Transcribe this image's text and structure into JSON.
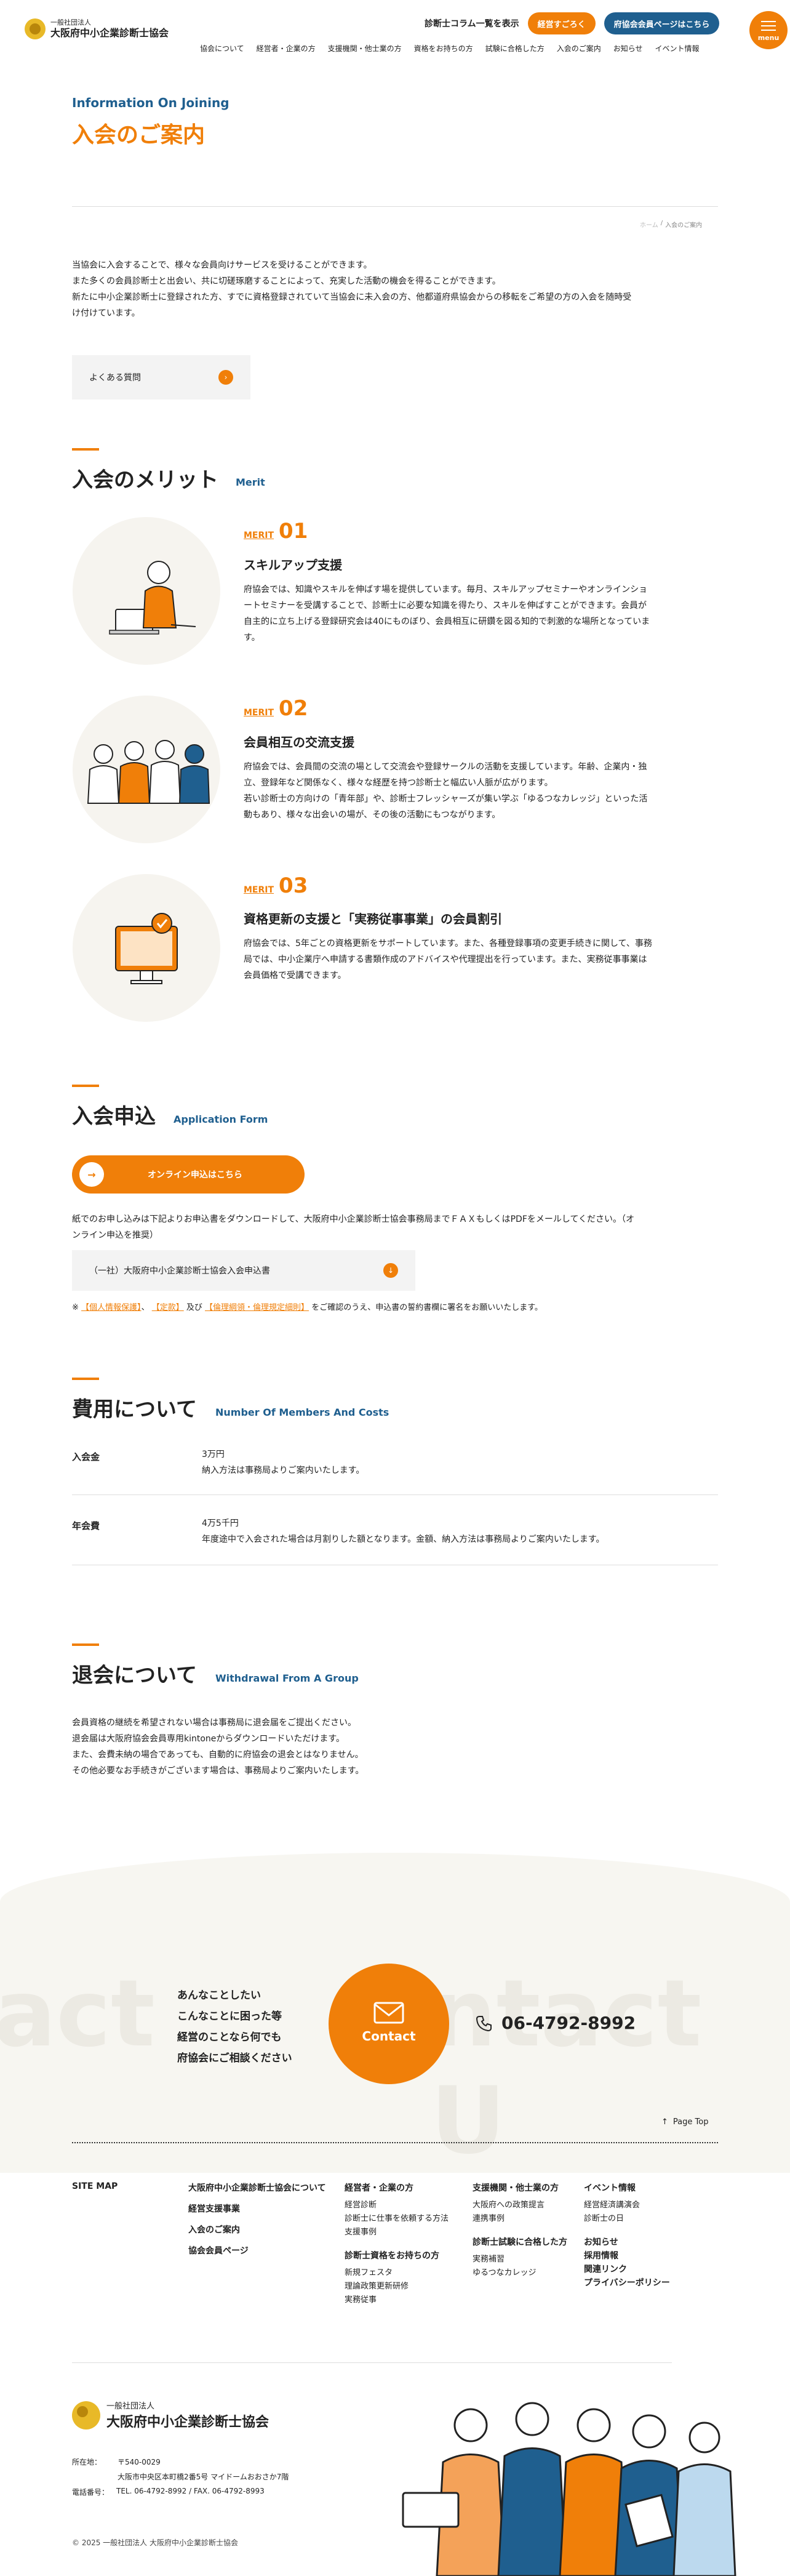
{
  "header": {
    "logo_small": "一般社団法人",
    "logo_large": "大阪府中小企業診断士協会",
    "column_link": "診断士コラム一覧を表示",
    "btn_join": "経営すごろく",
    "btn_member": "府協会会員ページはこちら",
    "menu_label": "menu",
    "nav": [
      "協会について",
      "経営者・企業の方",
      "支援機関・他士業の方",
      "資格をお持ちの方",
      "試験に合格した方",
      "入会のご案内",
      "お知らせ",
      "イベント情報"
    ]
  },
  "title": {
    "en": "Information On Joining",
    "ja": "入会のご案内",
    "breadcrumb_home": "ホーム",
    "breadcrumb_sep": "/",
    "breadcrumb_current": "入会のご案内"
  },
  "intro": {
    "lines": [
      "当協会に入会することで、様々な会員向けサービスを受けることができます。",
      "また多くの会員診断士と出会い、共に切磋琢磨することによって、充実した活動の機会を得ることができます。",
      "新たに中小企業診断士に登録された方、すでに資格登録されていて当協会に未入会の方、他都道府県協会からの移転をご希望の方の入会を随時受",
      "け付けています。"
    ],
    "faq_button": "よくある質問"
  },
  "merit": {
    "heading": "入会のメリット",
    "heading_en": "Merit",
    "label": "MERIT",
    "items": [
      {
        "num": "01",
        "title": "スキルアップ支援",
        "lines": [
          "府協会では、知識やスキルを伸ばす場を提供しています。毎月、スキルアップセミナーやオンラインショ",
          "ートセミナーを受講することで、診断士に必要な知識を得たり、スキルを伸ばすことができます。会員が",
          "自主的に立ち上げる登録研究会は40にものぼり、会員相互に研鑽を図る知的で刺激的な場所となっていま",
          "す。"
        ]
      },
      {
        "num": "02",
        "title": "会員相互の交流支援",
        "lines": [
          "府協会では、会員間の交流の場として交流会や登録サークルの活動を支援しています。年齢、企業内・独",
          "立、登録年など関係なく、様々な経歴を持つ診断士と幅広い人脈が広がります。",
          "若い診断士の方向けの「青年部」や、診断士フレッシャーズが集い学ぶ「ゆるつなカレッジ」といった活",
          "動もあり、様々な出会いの場が、その後の活動にもつながります。"
        ]
      },
      {
        "num": "03",
        "title": "資格更新の支援と「実務従事事業」の会員割引",
        "lines": [
          "府協会では、5年ごとの資格更新をサポートしています。また、各種登録事項の変更手続きに関して、事務",
          "局では、中小企業庁へ申請する書類作成のアドバイスや代理提出を行っています。また、実務従事事業は",
          "会員価格で受講できます。"
        ]
      }
    ]
  },
  "apply": {
    "heading": "入会申込",
    "heading_en": "Application Form",
    "online_button": "オンライン申込はこちら",
    "paper_lines": [
      "紙でのお申し込みは下記よりお申込書をダウンロードして、大阪府中小企業診断士協会事務局までＦＡＸもしくはPDFをメールしてください。（オ",
      "ンライン申込を推奨）"
    ],
    "download_button": "（一社）大阪府中小企業診断士協会入会申込書",
    "note_prefix": "※",
    "note_link1": "【個人情報保護】",
    "note_sep1": "、",
    "note_link2": "【定款】",
    "note_sep2": "及び",
    "note_link3": "【倫理綱領・倫理規定細則】",
    "note_suffix": "をご確認のうえ、申込書の誓約書欄に署名をお願いいたします。"
  },
  "cost": {
    "heading": "費用について",
    "heading_en": "Number Of Members And Costs",
    "rows": [
      {
        "label": "入会金",
        "value1": "3万円",
        "value2": "納入方法は事務局よりご案内いたします。"
      },
      {
        "label": "年会費",
        "value1": "4万5千円",
        "value2": "年度途中で入会された場合は月割りした額となります。金額、納入方法は事務局よりご案内いたします。"
      }
    ]
  },
  "withdraw": {
    "heading": "退会について",
    "heading_en": "Withdrawal From A Group",
    "lines": [
      "会員資格の継続を希望されない場合は事務局に退会届をご提出ください。",
      "退会届は大阪府協会会員専用kintoneからダウンロードいただけます。",
      "また、会費未納の場合であっても、自動的に府協会の退会とはなりません。",
      "その他必要なお手続きがございます場合は、事務局よりご案内いたします。"
    ]
  },
  "contact": {
    "bg_left": "act",
    "bg_right": "ntact U",
    "lines": [
      "あんなことしたい",
      "こんなことに困った等",
      "経営のことなら何でも",
      "府協会にご相談ください"
    ],
    "button": "Contact",
    "phone": "06-4792-8992"
  },
  "footer": {
    "page_top": "Page Top",
    "sitemap": "SITE MAP",
    "col1": [
      "大阪府中小企業診断士協会について",
      "経営支援事業",
      "入会のご案内",
      "協会会員ページ"
    ],
    "col2_head": "経営者・企業の方",
    "col2": [
      "経営診断",
      "診断士に仕事を依頼する方法",
      "支援事例"
    ],
    "col2b_head": "診断士資格をお持ちの方",
    "col2b": [
      "新規フェスタ",
      "理論政策更新研修",
      "実務従事"
    ],
    "col3_head": "支援機関・他士業の方",
    "col3": [
      "大阪府への政策提言",
      "連携事例"
    ],
    "col3b_head": "診断士試験に合格した方",
    "col3b": [
      "実務補習",
      "ゆるつなカレッジ"
    ],
    "col4_head": "イベント情報",
    "col4": [
      "経営経済講演会",
      "診断士の日"
    ],
    "col4b": [
      "お知らせ",
      "採用情報",
      "関連リンク",
      "プライバシーポリシー"
    ],
    "logo_small": "一般社団法人",
    "logo_large": "大阪府中小企業診断士協会",
    "addr_label": "所在地：",
    "addr1": "〒540-0029",
    "addr2": "大阪市中央区本町橋2番5号 マイドームおおさか7階",
    "tel_label": "電話番号：",
    "tel": "TEL. 06-4792-8992 / FAX. 06-4792-8993",
    "copyright": "© 2025 一般社団法人 大阪府中小企業診断士協会"
  },
  "colors": {
    "accent": "#f07f09",
    "navy": "#1f5f8f"
  }
}
